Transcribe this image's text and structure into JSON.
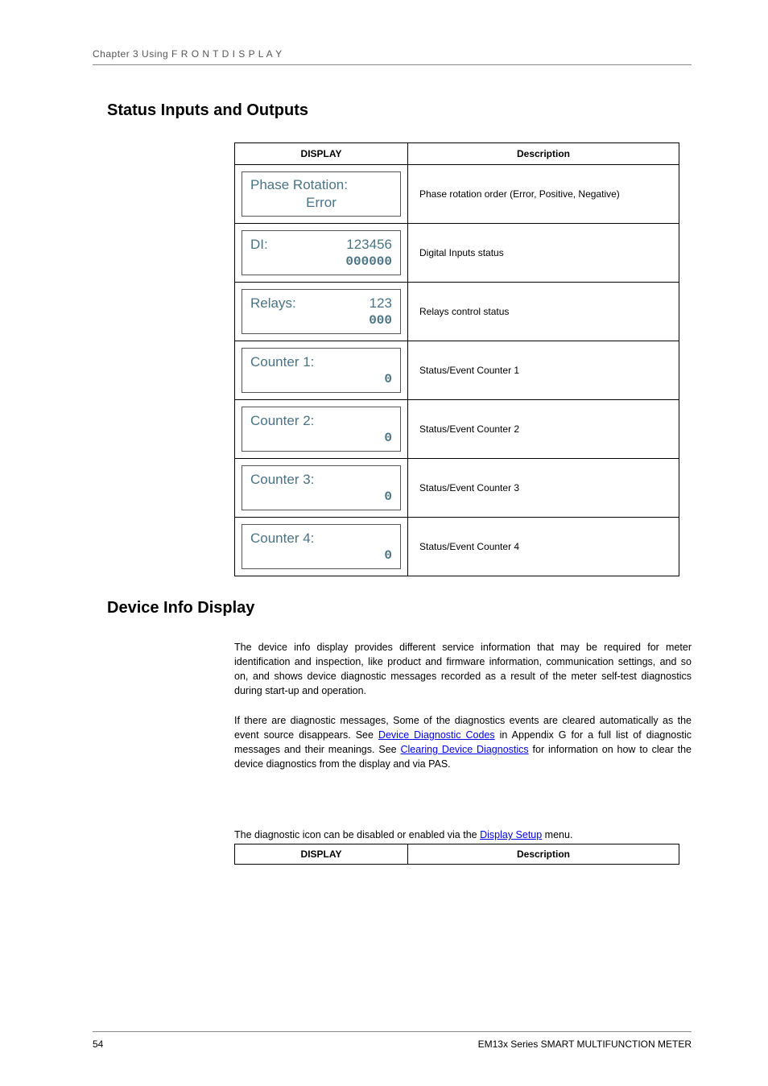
{
  "header": "Chapter 3   Using  F R O N T   D I S P L A Y",
  "section1_title": "Status Inputs and Outputs",
  "table1": {
    "col1": "DISPLAY",
    "col2": "Description",
    "rows": [
      {
        "label": "Phase Rotation:",
        "right": "",
        "line2": "Error",
        "centered": true,
        "desc": "Phase rotation order (Error, Positive, Negative)"
      },
      {
        "label": "DI:",
        "right": "123456",
        "line2": "000000",
        "centered": false,
        "desc": "Digital Inputs status"
      },
      {
        "label": "Relays:",
        "right": "123",
        "line2": "000",
        "centered": false,
        "desc": "Relays control status"
      },
      {
        "label": "Counter  1:",
        "right": "",
        "line2": "0",
        "centered": false,
        "desc": "Status/Event Counter 1"
      },
      {
        "label": "Counter  2:",
        "right": "",
        "line2": "0",
        "centered": false,
        "desc": "Status/Event Counter 2"
      },
      {
        "label": "Counter  3:",
        "right": "",
        "line2": "0",
        "centered": false,
        "desc": "Status/Event Counter 3"
      },
      {
        "label": "Counter  4:",
        "right": "",
        "line2": "0",
        "centered": false,
        "desc": "Status/Event Counter 4"
      }
    ]
  },
  "section2_title": "Device Info Display",
  "para1": "The device info display provides different service information that may be required for meter identification and inspection, like product and firmware information, communication settings, and so on, and shows device diagnostic messages recorded as a result of the meter self-test diagnostics during start-up and operation.",
  "para2_a": "If there are diagnostic messages, Some of the diagnostics events are cleared automatically as the event source disappears. See ",
  "para2_link1": "Device Diagnostic Codes",
  "para2_b": " in Appendix G for a full list of diagnostic messages and their meanings. See ",
  "para2_link2": "Clearing Device Diagnostics",
  "para2_c": " for information on how to clear the device diagnostics from the display and via PAS.",
  "para3_a": "The diagnostic icon can be disabled or enabled via the ",
  "para3_link": "Display Setup",
  "para3_b": " menu.",
  "table2": {
    "col1": "DISPLAY",
    "col2": "Description"
  },
  "footer": {
    "page": "54",
    "title": "EM13x Series SMART MULTIFUNCTION METER"
  }
}
